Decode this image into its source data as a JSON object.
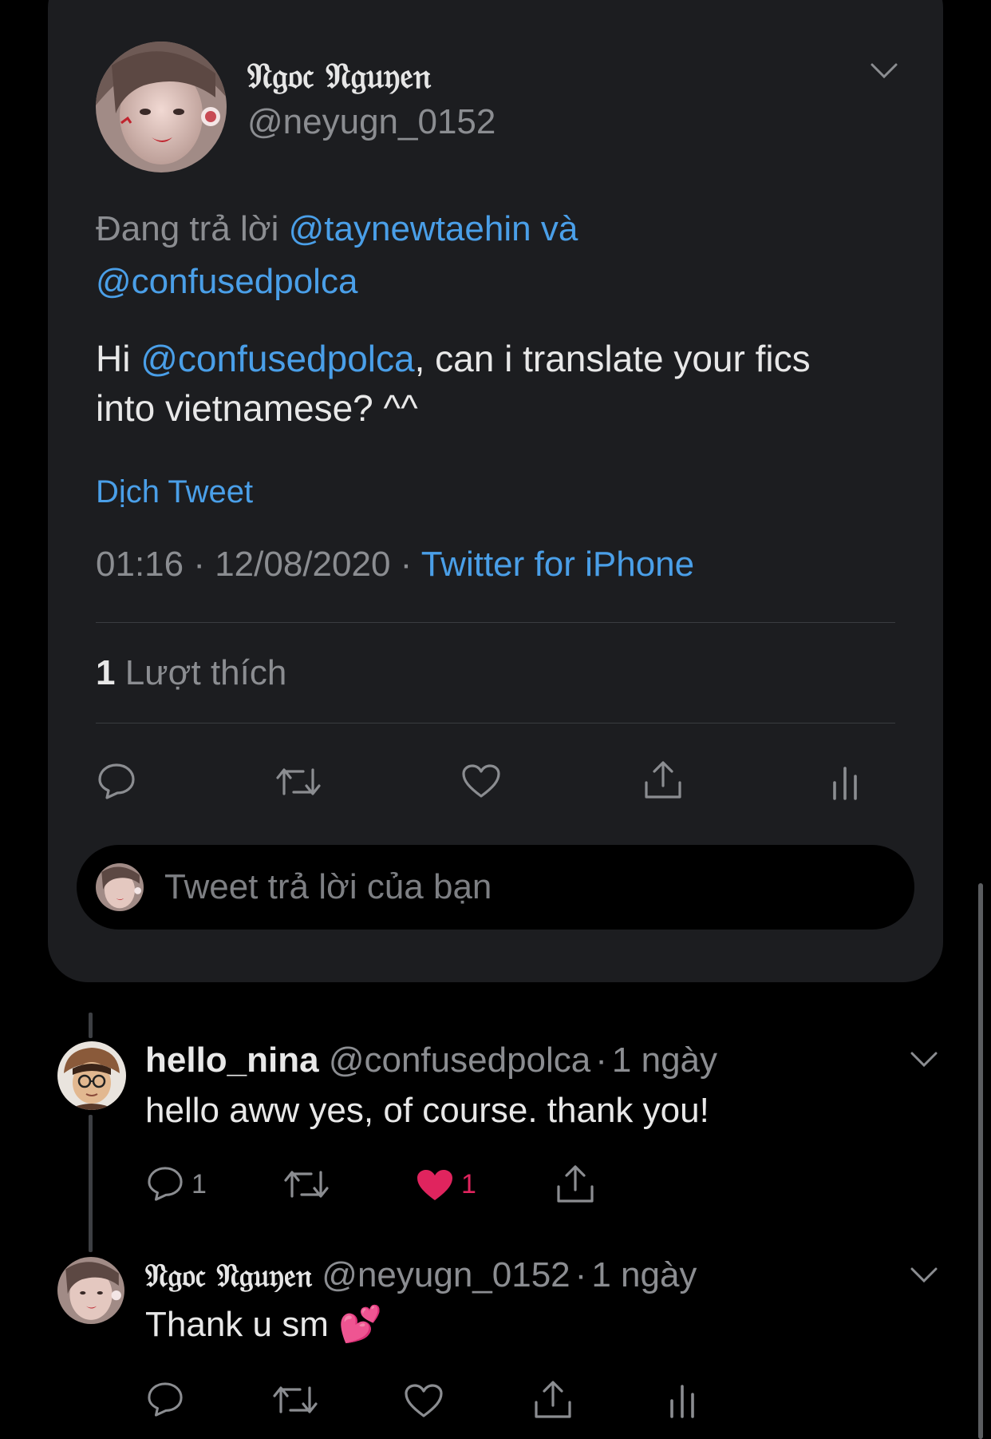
{
  "tweet": {
    "display_name": "𝔑𝔤𝔬𝔠 𝔑𝔤𝔲𝔶𝔢𝔫",
    "handle": "@neyugn_0152",
    "replying_prefix": "Đang trả lời ",
    "replying_to_1": "@taynewtaehin",
    "replying_and": " và",
    "replying_to_2": "@confusedpolca",
    "text_hi": "Hi ",
    "text_mention": "@confusedpolca",
    "text_rest": ", can i translate your fics",
    "text_line2": "into vietnamese? ^^",
    "translate_link": "Dịch Tweet",
    "timestamp": "01:16 · 12/08/2020 · ",
    "source": "Twitter for iPhone",
    "likes_count": "1",
    "likes_label": " Lượt thích",
    "reply_placeholder": "Tweet trả lời của bạn"
  },
  "replies": [
    {
      "display_name": "hello_nina",
      "handle": "@confusedpolca",
      "dot": "·",
      "time": "1 ngày",
      "text": "hello aww yes, of course. thank you!",
      "reply_count": "1",
      "like_count": "1",
      "liked": true
    },
    {
      "display_name": "𝔑𝔤𝔬𝔠 𝔑𝔤𝔲𝔶𝔢𝔫",
      "handle": "@neyugn_0152",
      "dot": "·",
      "time": "1 ngày",
      "text": "Thank u sm 💕"
    }
  ],
  "colors": {
    "accent": "#4a9fe8",
    "like": "#e0245e",
    "card": "#1c1d20",
    "background": "#000000"
  },
  "icons": [
    "chevron-down-icon",
    "reply-icon",
    "retweet-icon",
    "heart-icon",
    "share-icon",
    "analytics-icon"
  ]
}
